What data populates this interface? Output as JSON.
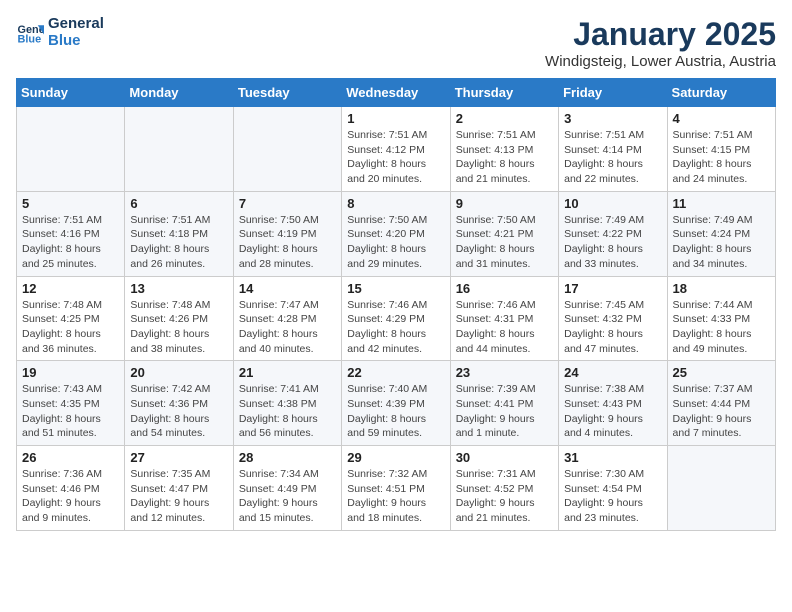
{
  "logo": {
    "line1": "General",
    "line2": "Blue"
  },
  "title": "January 2025",
  "location": "Windigsteig, Lower Austria, Austria",
  "weekdays": [
    "Sunday",
    "Monday",
    "Tuesday",
    "Wednesday",
    "Thursday",
    "Friday",
    "Saturday"
  ],
  "weeks": [
    [
      {
        "day": "",
        "info": ""
      },
      {
        "day": "",
        "info": ""
      },
      {
        "day": "",
        "info": ""
      },
      {
        "day": "1",
        "info": "Sunrise: 7:51 AM\nSunset: 4:12 PM\nDaylight: 8 hours\nand 20 minutes."
      },
      {
        "day": "2",
        "info": "Sunrise: 7:51 AM\nSunset: 4:13 PM\nDaylight: 8 hours\nand 21 minutes."
      },
      {
        "day": "3",
        "info": "Sunrise: 7:51 AM\nSunset: 4:14 PM\nDaylight: 8 hours\nand 22 minutes."
      },
      {
        "day": "4",
        "info": "Sunrise: 7:51 AM\nSunset: 4:15 PM\nDaylight: 8 hours\nand 24 minutes."
      }
    ],
    [
      {
        "day": "5",
        "info": "Sunrise: 7:51 AM\nSunset: 4:16 PM\nDaylight: 8 hours\nand 25 minutes."
      },
      {
        "day": "6",
        "info": "Sunrise: 7:51 AM\nSunset: 4:18 PM\nDaylight: 8 hours\nand 26 minutes."
      },
      {
        "day": "7",
        "info": "Sunrise: 7:50 AM\nSunset: 4:19 PM\nDaylight: 8 hours\nand 28 minutes."
      },
      {
        "day": "8",
        "info": "Sunrise: 7:50 AM\nSunset: 4:20 PM\nDaylight: 8 hours\nand 29 minutes."
      },
      {
        "day": "9",
        "info": "Sunrise: 7:50 AM\nSunset: 4:21 PM\nDaylight: 8 hours\nand 31 minutes."
      },
      {
        "day": "10",
        "info": "Sunrise: 7:49 AM\nSunset: 4:22 PM\nDaylight: 8 hours\nand 33 minutes."
      },
      {
        "day": "11",
        "info": "Sunrise: 7:49 AM\nSunset: 4:24 PM\nDaylight: 8 hours\nand 34 minutes."
      }
    ],
    [
      {
        "day": "12",
        "info": "Sunrise: 7:48 AM\nSunset: 4:25 PM\nDaylight: 8 hours\nand 36 minutes."
      },
      {
        "day": "13",
        "info": "Sunrise: 7:48 AM\nSunset: 4:26 PM\nDaylight: 8 hours\nand 38 minutes."
      },
      {
        "day": "14",
        "info": "Sunrise: 7:47 AM\nSunset: 4:28 PM\nDaylight: 8 hours\nand 40 minutes."
      },
      {
        "day": "15",
        "info": "Sunrise: 7:46 AM\nSunset: 4:29 PM\nDaylight: 8 hours\nand 42 minutes."
      },
      {
        "day": "16",
        "info": "Sunrise: 7:46 AM\nSunset: 4:31 PM\nDaylight: 8 hours\nand 44 minutes."
      },
      {
        "day": "17",
        "info": "Sunrise: 7:45 AM\nSunset: 4:32 PM\nDaylight: 8 hours\nand 47 minutes."
      },
      {
        "day": "18",
        "info": "Sunrise: 7:44 AM\nSunset: 4:33 PM\nDaylight: 8 hours\nand 49 minutes."
      }
    ],
    [
      {
        "day": "19",
        "info": "Sunrise: 7:43 AM\nSunset: 4:35 PM\nDaylight: 8 hours\nand 51 minutes."
      },
      {
        "day": "20",
        "info": "Sunrise: 7:42 AM\nSunset: 4:36 PM\nDaylight: 8 hours\nand 54 minutes."
      },
      {
        "day": "21",
        "info": "Sunrise: 7:41 AM\nSunset: 4:38 PM\nDaylight: 8 hours\nand 56 minutes."
      },
      {
        "day": "22",
        "info": "Sunrise: 7:40 AM\nSunset: 4:39 PM\nDaylight: 8 hours\nand 59 minutes."
      },
      {
        "day": "23",
        "info": "Sunrise: 7:39 AM\nSunset: 4:41 PM\nDaylight: 9 hours\nand 1 minute."
      },
      {
        "day": "24",
        "info": "Sunrise: 7:38 AM\nSunset: 4:43 PM\nDaylight: 9 hours\nand 4 minutes."
      },
      {
        "day": "25",
        "info": "Sunrise: 7:37 AM\nSunset: 4:44 PM\nDaylight: 9 hours\nand 7 minutes."
      }
    ],
    [
      {
        "day": "26",
        "info": "Sunrise: 7:36 AM\nSunset: 4:46 PM\nDaylight: 9 hours\nand 9 minutes."
      },
      {
        "day": "27",
        "info": "Sunrise: 7:35 AM\nSunset: 4:47 PM\nDaylight: 9 hours\nand 12 minutes."
      },
      {
        "day": "28",
        "info": "Sunrise: 7:34 AM\nSunset: 4:49 PM\nDaylight: 9 hours\nand 15 minutes."
      },
      {
        "day": "29",
        "info": "Sunrise: 7:32 AM\nSunset: 4:51 PM\nDaylight: 9 hours\nand 18 minutes."
      },
      {
        "day": "30",
        "info": "Sunrise: 7:31 AM\nSunset: 4:52 PM\nDaylight: 9 hours\nand 21 minutes."
      },
      {
        "day": "31",
        "info": "Sunrise: 7:30 AM\nSunset: 4:54 PM\nDaylight: 9 hours\nand 23 minutes."
      },
      {
        "day": "",
        "info": ""
      }
    ]
  ]
}
